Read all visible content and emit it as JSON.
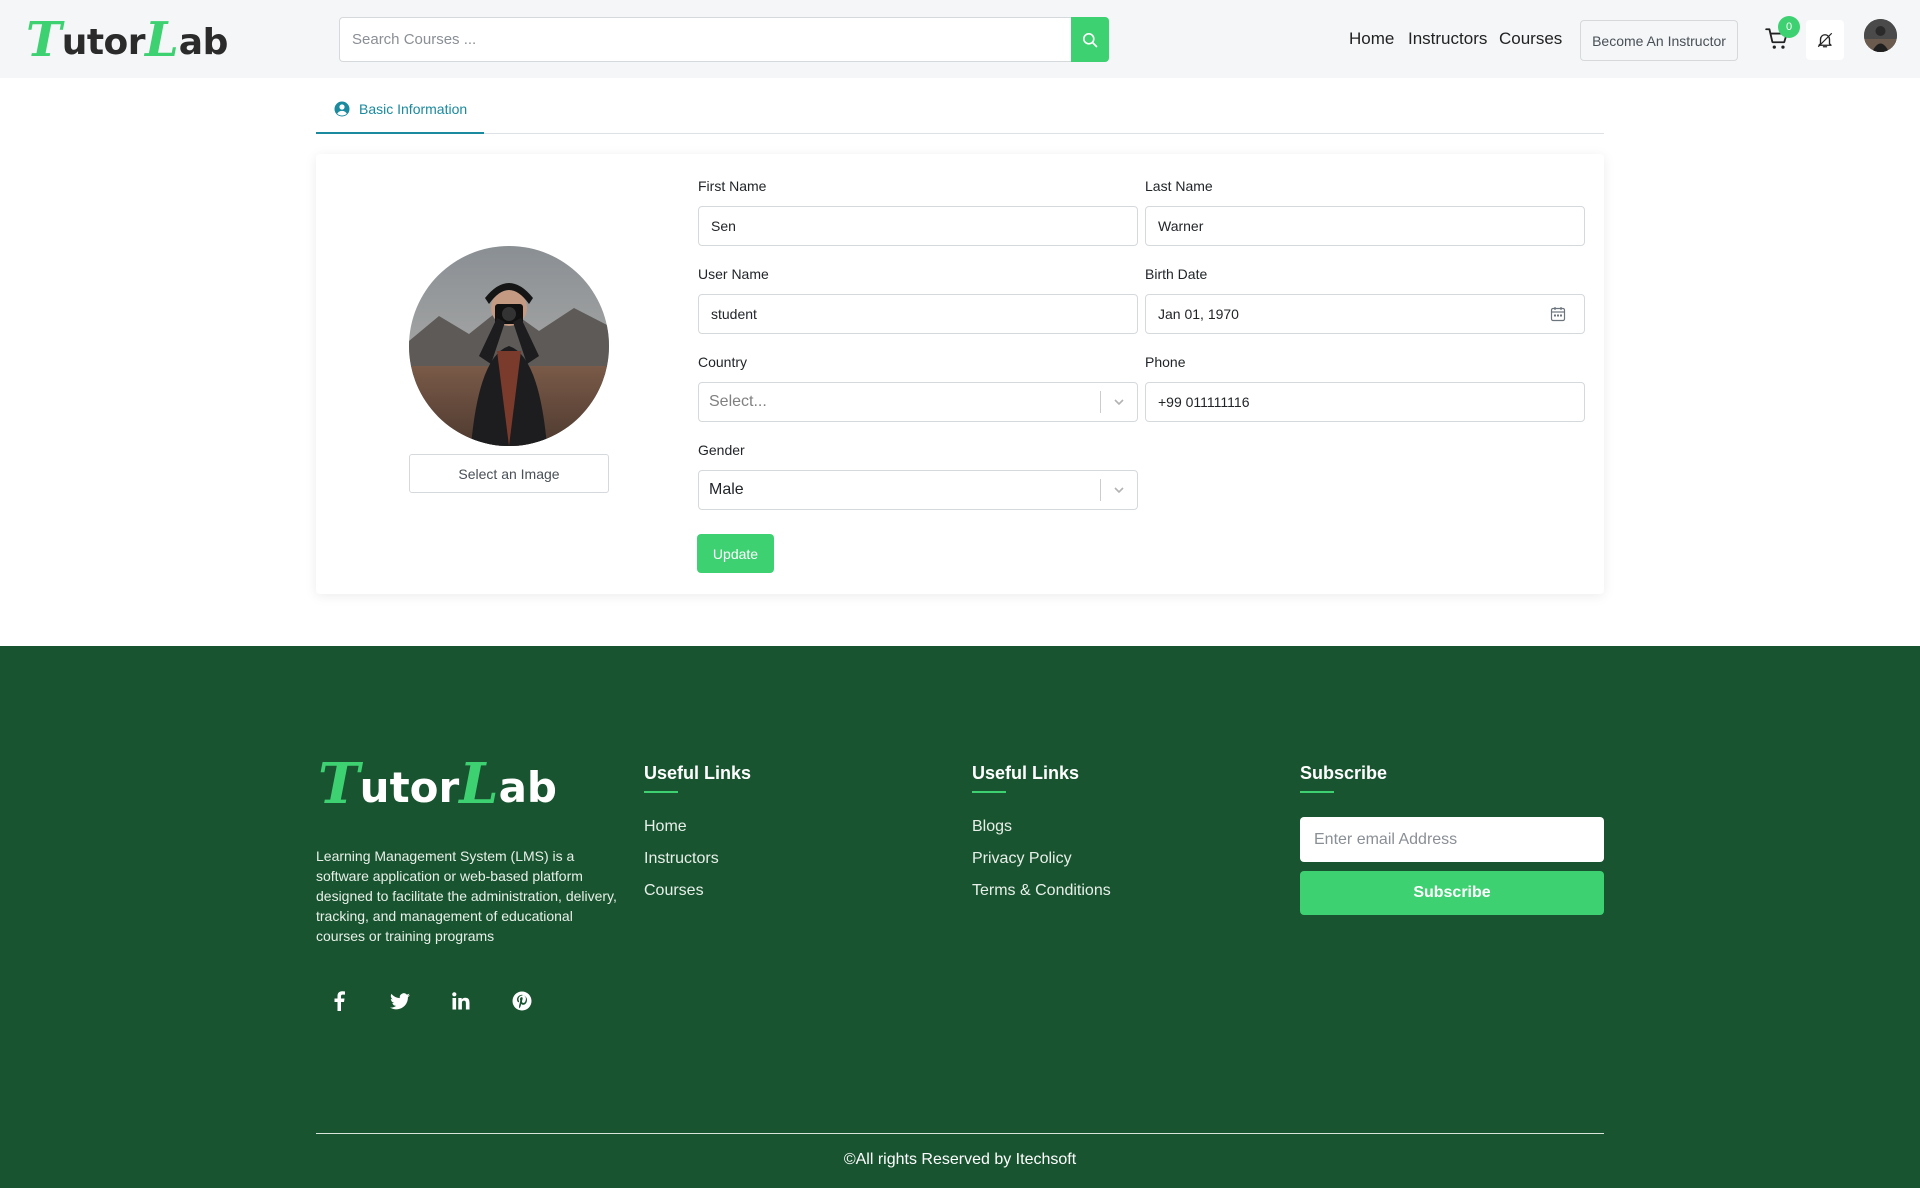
{
  "header": {
    "logo": {
      "first": "T",
      "middle": "utor",
      "second": "L",
      "last": "ab"
    },
    "search": {
      "placeholder": "Search Courses ..."
    },
    "nav": [
      "Home",
      "Instructors",
      "Courses"
    ],
    "become_instructor": "Become An Instructor",
    "cart_count": "0",
    "icons": {
      "search": "search-icon",
      "cart": "cart-icon",
      "notification": "bell-icon",
      "avatar": "user-avatar"
    }
  },
  "tabs": [
    {
      "label": "Basic Information",
      "active": true,
      "icon": "user-circle-icon"
    }
  ],
  "profile": {
    "select_image_label": "Select an Image",
    "fields": {
      "first_name": {
        "label": "First Name",
        "value": "Sen"
      },
      "last_name": {
        "label": "Last Name",
        "value": "Warner"
      },
      "user_name": {
        "label": "User Name",
        "value": "student"
      },
      "birth_date": {
        "label": "Birth Date",
        "value": "Jan 01, 1970"
      },
      "country": {
        "label": "Country",
        "placeholder": "Select..."
      },
      "phone": {
        "label": "Phone",
        "value": "+99 011111116"
      },
      "gender": {
        "label": "Gender",
        "value": "Male"
      }
    },
    "update_label": "Update"
  },
  "footer": {
    "logo": {
      "first": "T",
      "middle": "utor",
      "second": "L",
      "last": "ab"
    },
    "description": "Learning Management System (LMS) is a software application or web-based platform designed to facilitate the administration, delivery, tracking, and management of educational courses or training programs",
    "social": [
      "facebook-icon",
      "twitter-icon",
      "linkedin-icon",
      "pinterest-icon"
    ],
    "useful_links_1": {
      "title": "Useful Links",
      "links": [
        "Home",
        "Instructors",
        "Courses"
      ]
    },
    "useful_links_2": {
      "title": "Useful Links",
      "links": [
        "Blogs",
        "Privacy Policy",
        "Terms & Conditions"
      ]
    },
    "subscribe": {
      "title": "Subscribe",
      "placeholder": "Enter email Address",
      "button": "Subscribe"
    },
    "copyright": "©All rights Reserved by Itechsoft"
  },
  "colors": {
    "brand_green": "#3ed172",
    "footer_bg": "#18542f",
    "tab_accent": "#1a8a9f",
    "header_bg": "#f4f6f8"
  }
}
